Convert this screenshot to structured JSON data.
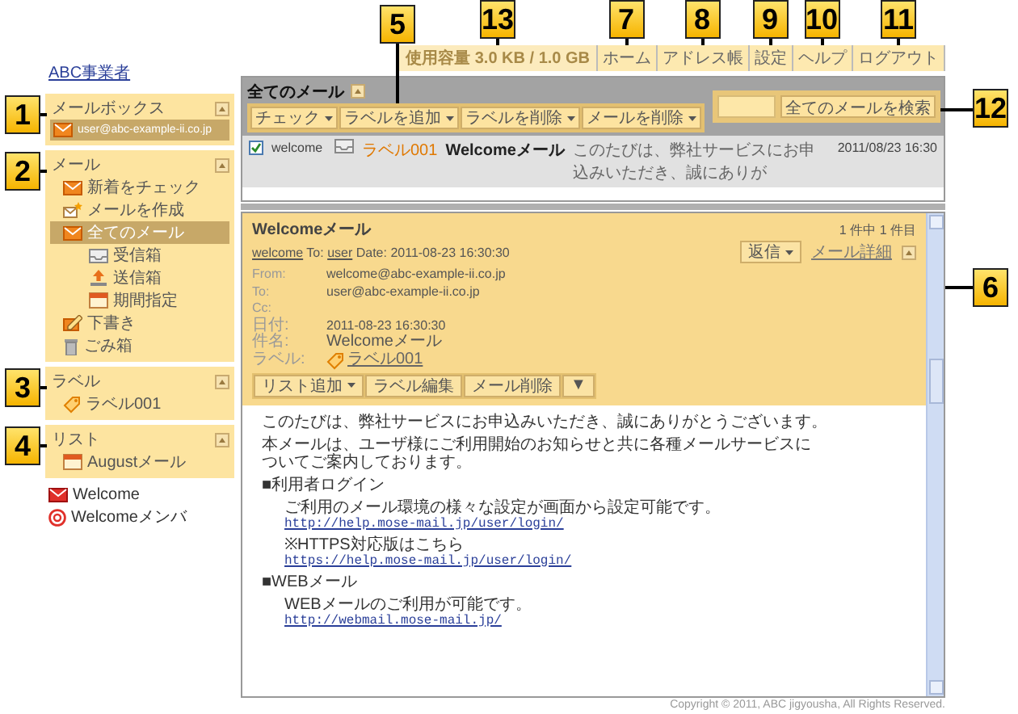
{
  "sidebar": {
    "company_link": "ABC事業者",
    "panels": [
      {
        "title": "メールボックス",
        "callout": "1",
        "items": [
          {
            "label": "user@abc-example-ii.co.jp",
            "selected": true
          }
        ]
      },
      {
        "title": "メール",
        "callout": "2",
        "items": [
          {
            "label": "新着をチェック",
            "selected": false
          },
          {
            "label": "メールを作成",
            "selected": false
          },
          {
            "label": "全てのメール",
            "selected": true,
            "children": [
              {
                "label": "受信箱",
                "selected": false
              },
              {
                "label": "送信箱",
                "selected": false
              },
              {
                "label": "期間指定",
                "selected": false
              }
            ]
          },
          {
            "label": "下書き",
            "selected": false
          },
          {
            "label": "ごみ箱",
            "selected": false
          }
        ]
      },
      {
        "title": "ラベル",
        "callout": "3",
        "items": [
          {
            "label": "ラベル001",
            "selected": false
          }
        ]
      },
      {
        "title": "リスト",
        "callout": "4",
        "items": [
          {
            "label": "Augustメール",
            "selected": false
          }
        ]
      }
    ],
    "list_entries": [
      {
        "label": "Welcome",
        "selected": false
      },
      {
        "label": "Welcomeメンバ",
        "selected": false
      }
    ]
  },
  "header": {
    "usage": {
      "text": "使用容量 3.0 KB / 1.0 GB",
      "callout": "13"
    },
    "links": [
      {
        "label": "ホーム",
        "callout": "7"
      },
      {
        "label": "アドレス帳",
        "callout": "8"
      },
      {
        "label": "設定",
        "callout": "9"
      },
      {
        "label": "ヘルプ",
        "callout": "10"
      },
      {
        "label": "ログアウト",
        "callout": "11"
      }
    ]
  },
  "mail_list": {
    "title": "全てのメール",
    "toolbar_callout": "5",
    "toolbar": [
      "チェック",
      "ラベルを追加",
      "ラベルを削除",
      "メールを削除"
    ],
    "search": {
      "button": "全てのメールを検索",
      "callout": "12"
    },
    "rows": [
      {
        "checked": true,
        "from": "welcome",
        "label": "ラベル001",
        "subject": "Welcomeメール",
        "snippet": "このたびは、弊社サービスにお申込みいただき、誠にありが",
        "date": "2011/08/23 16:30"
      }
    ]
  },
  "preview": {
    "title": "Welcomeメール",
    "count": "1 件中 1 件目",
    "callout": "6",
    "sender": "welcome",
    "to_label": "To:",
    "recipient": "user",
    "date_label": "Date:",
    "date": "2011-08-23 16:30:30",
    "reply_button": "返信",
    "details_link": "メール詳細",
    "fields": [
      {
        "kind": "text",
        "label": "From:",
        "value": "welcome@abc-example-ii.co.jp"
      },
      {
        "kind": "text",
        "label": "To:",
        "value": "user@abc-example-ii.co.jp"
      },
      {
        "kind": "text",
        "label": "Cc:"
      },
      {
        "kind": "text",
        "label": "日付:",
        "value": "2011-08-23 16:30:30"
      },
      {
        "kind": "text",
        "label": "件名:",
        "value": "Welcomeメール"
      },
      {
        "kind": "tag",
        "label": "ラベル:",
        "value": "ラベル001"
      }
    ],
    "actions": [
      {
        "label": "リスト追加",
        "dropdown": true
      },
      {
        "label": "ラベル編集",
        "dropdown": false
      },
      {
        "label": "メール削除",
        "dropdown": false
      },
      {
        "label": "▼",
        "dropdown": false
      }
    ],
    "body": [
      {
        "kind": "paragraph",
        "lines": [
          {
            "kind": "text",
            "text": "このたびは、弊社サービスにお申込みいただき、誠にありがとうございます。"
          }
        ]
      },
      {
        "kind": "paragraph",
        "lines": [
          {
            "kind": "text",
            "text": "本メールは、ユーザ様にご利用開始のお知らせと共に各種メールサービスに"
          },
          {
            "kind": "text",
            "text": "ついてご案内しております。"
          }
        ]
      },
      {
        "kind": "heading",
        "lines": [
          {
            "kind": "text",
            "text": "■利用者ログイン"
          }
        ]
      },
      {
        "kind": "indent",
        "lines": [
          {
            "kind": "text",
            "text": "ご利用のメール環境の様々な設定が画面から設定可能です。"
          },
          {
            "kind": "link",
            "text": "http://help.mose-mail.jp/user/login/"
          }
        ]
      },
      {
        "kind": "indent",
        "lines": [
          {
            "kind": "text",
            "text": "※HTTPS対応版はこちら"
          },
          {
            "kind": "link",
            "text": "https://help.mose-mail.jp/user/login/"
          }
        ]
      },
      {
        "kind": "heading",
        "lines": [
          {
            "kind": "text",
            "text": "■WEBメール"
          }
        ]
      },
      {
        "kind": "indent",
        "lines": [
          {
            "kind": "text",
            "text": "WEBメールのご利用が可能です。"
          },
          {
            "kind": "link",
            "text": "http://webmail.mose-mail.jp/"
          }
        ]
      }
    ]
  },
  "copyright": "Copyright © 2011, ABC jigyousha, All Rights Reserved."
}
